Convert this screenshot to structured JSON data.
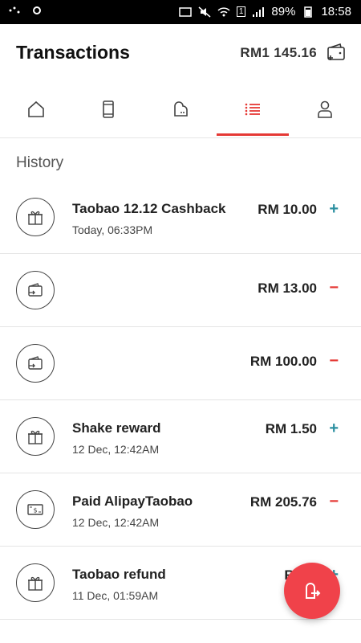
{
  "status_bar": {
    "battery": "89%",
    "time": "18:58",
    "sim_badge": "1",
    "icons": [
      "signal-dots-icon",
      "cast-icon",
      "mute-icon",
      "wifi-icon",
      "cellular-icon",
      "battery-icon"
    ]
  },
  "header": {
    "title": "Transactions",
    "balance": "RM1 145.16",
    "wallet_icon": "wallet-add-icon"
  },
  "tabs": [
    {
      "name": "home",
      "icon": "home-icon",
      "active": false
    },
    {
      "name": "phone",
      "icon": "phone-icon",
      "active": false
    },
    {
      "name": "pay",
      "icon": "pay-icon",
      "active": false
    },
    {
      "name": "transactions",
      "icon": "list-icon",
      "active": true
    },
    {
      "name": "profile",
      "icon": "profile-icon",
      "active": false
    }
  ],
  "section_title": "History",
  "transactions": [
    {
      "icon": "gift-icon",
      "name": "Taobao 12.12 Cashback",
      "time": "Today, 06:33PM",
      "amount": "RM 10.00",
      "sign": "+"
    },
    {
      "icon": "wallet-transfer-icon",
      "name": "",
      "time": "",
      "amount": "RM 13.00",
      "sign": "−"
    },
    {
      "icon": "wallet-transfer-icon",
      "name": "",
      "time": "",
      "amount": "RM 100.00",
      "sign": "−"
    },
    {
      "icon": "gift-icon",
      "name": "Shake reward",
      "time": "12 Dec, 12:42AM",
      "amount": "RM 1.50",
      "sign": "+"
    },
    {
      "icon": "cash-icon",
      "name": "Paid AlipayTaobao",
      "time": "12 Dec, 12:42AM",
      "amount": "RM 205.76",
      "sign": "−"
    },
    {
      "icon": "gift-icon",
      "name": "Taobao refund",
      "time": "11 Dec, 01:59AM",
      "amount": "RM 4",
      "sign": "+"
    }
  ],
  "colors": {
    "accent": "#e53935",
    "plus": "#2b8fa0",
    "fab": "#f0424a"
  },
  "fab": {
    "icon": "transfer-out-icon"
  }
}
